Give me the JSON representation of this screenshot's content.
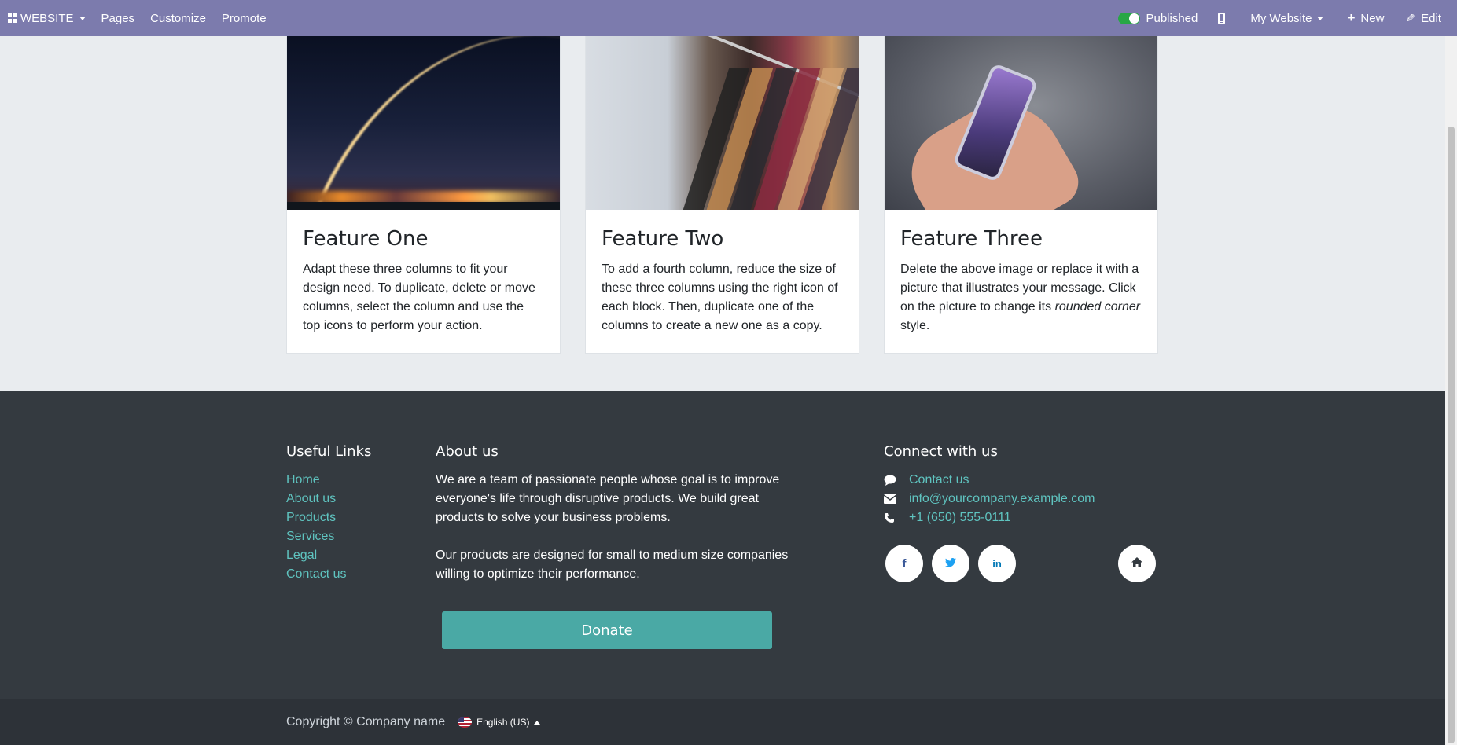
{
  "topbar": {
    "app_label": "WEBSITE",
    "menu": [
      "Pages",
      "Customize",
      "Promote"
    ],
    "published_label": "Published",
    "website_label": "My Website",
    "new_label": "New",
    "edit_label": "Edit"
  },
  "features": [
    {
      "title": "Feature One",
      "text": "Adapt these three columns to fit your design need. To duplicate, delete or move columns, select the column and use the top icons to perform your action."
    },
    {
      "title": "Feature Two",
      "text": "To add a fourth column, reduce the size of these three columns using the right icon of each block. Then, duplicate one of the columns to create a new one as a copy."
    },
    {
      "title": "Feature Three",
      "text_before": "Delete the above image or replace it with a picture that illustrates your message. Click on the picture to change its ",
      "text_em": "rounded corner",
      "text_after": " style."
    }
  ],
  "footer": {
    "useful_links_title": "Useful Links",
    "links": [
      "Home",
      "About us",
      "Products",
      "Services",
      "Legal",
      "Contact us"
    ],
    "about_title": "About us",
    "about_p1": "We are a team of passionate people whose goal is to improve everyone's life through disruptive products. We build great products to solve your business problems.",
    "about_p2": "Our products are designed for small to medium size companies willing to optimize their performance.",
    "donate_label": "Donate",
    "connect_title": "Connect with us",
    "contact_label": "Contact us",
    "email": "info@yourcompany.example.com",
    "phone": "+1 (650) 555-0111",
    "social_icons": [
      "facebook-icon",
      "twitter-icon",
      "linkedin-icon",
      "home-icon"
    ]
  },
  "copyright": {
    "text": "Copyright © Company name",
    "language": "English (US)"
  },
  "colors": {
    "topbar": "#7c7bad",
    "footer": "#343a40",
    "link": "#5fc4c0",
    "donate": "#4aa9a5"
  }
}
